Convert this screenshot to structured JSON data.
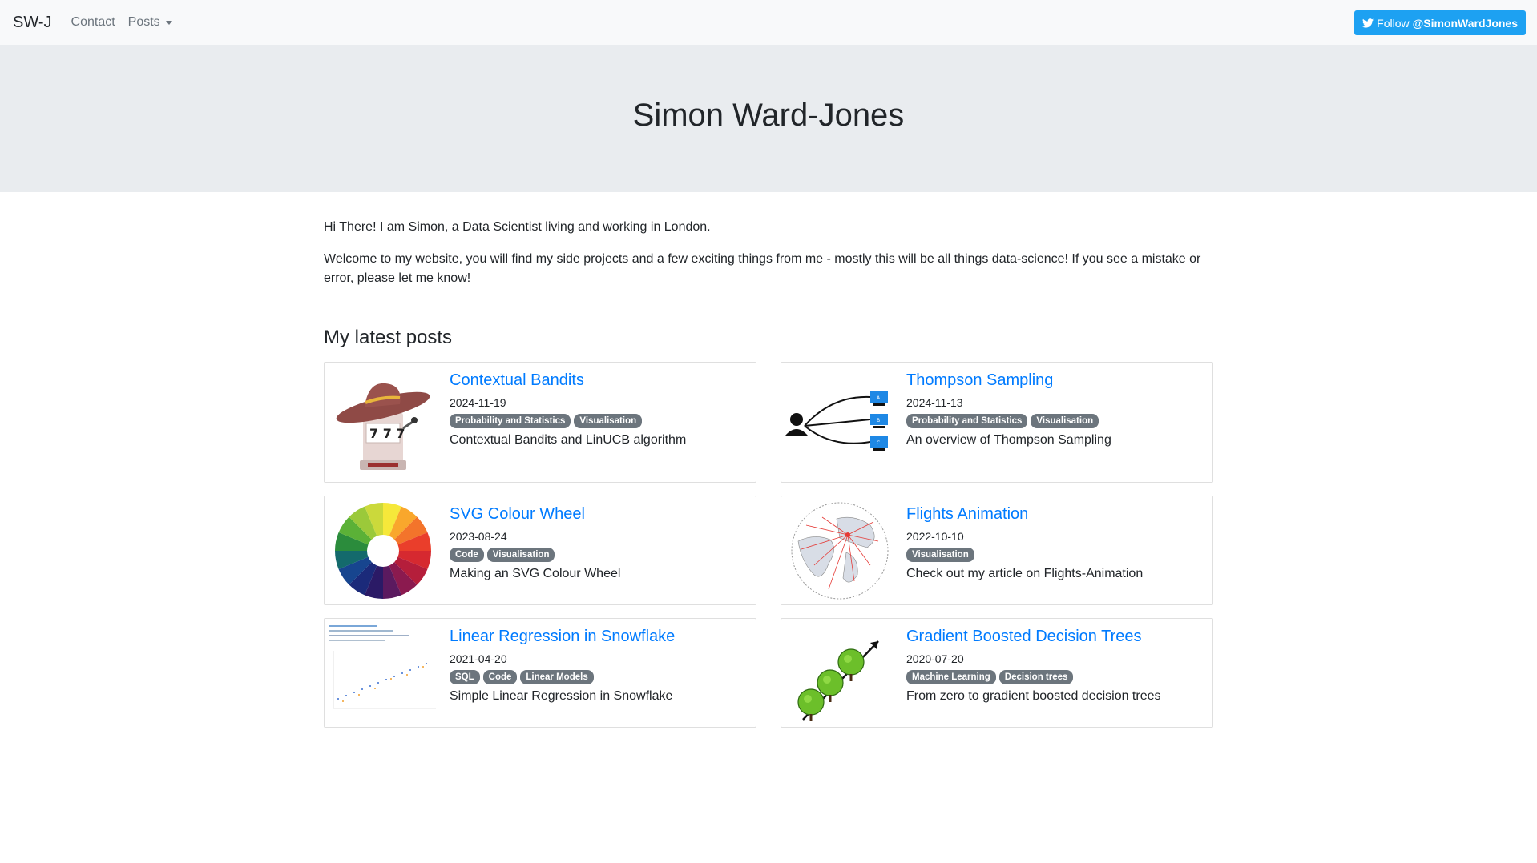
{
  "nav": {
    "brand": "SW-J",
    "contact": "Contact",
    "posts": "Posts",
    "follow_prefix": "Follow",
    "follow_handle": "@SimonWardJones"
  },
  "hero": {
    "title": "Simon Ward-Jones"
  },
  "intro": [
    "Hi There! I am Simon, a Data Scientist living and working in London.",
    "Welcome to my website, you will find my side projects and a few exciting things from me - mostly this will be all things data-science! If you see a mistake or error, please let me know!"
  ],
  "section_title": "My latest posts",
  "posts": [
    {
      "title": "Contextual Bandits",
      "date": "2024-11-19",
      "tags": [
        "Probability and Statistics",
        "Visualisation"
      ],
      "description": "Contextual Bandits and LinUCB algorithm",
      "icon": "slot-machine-cowboy-icon"
    },
    {
      "title": "Thompson Sampling",
      "date": "2024-11-13",
      "tags": [
        "Probability and Statistics",
        "Visualisation"
      ],
      "description": "An overview of Thompson Sampling",
      "icon": "user-choice-diagram-icon"
    },
    {
      "title": "SVG Colour Wheel",
      "date": "2023-08-24",
      "tags": [
        "Code",
        "Visualisation"
      ],
      "description": "Making an SVG Colour Wheel",
      "icon": "colour-wheel-icon"
    },
    {
      "title": "Flights Animation",
      "date": "2022-10-10",
      "tags": [
        "Visualisation"
      ],
      "description": "Check out my article on Flights-Animation",
      "icon": "globe-flights-icon"
    },
    {
      "title": "Linear Regression in Snowflake",
      "date": "2021-04-20",
      "tags": [
        "SQL",
        "Code",
        "Linear Models"
      ],
      "description": "Simple Linear Regression in Snowflake",
      "icon": "regression-plot-icon"
    },
    {
      "title": "Gradient Boosted Decision Trees",
      "date": "2020-07-20",
      "tags": [
        "Machine Learning",
        "Decision trees"
      ],
      "description": "From zero to gradient boosted decision trees",
      "icon": "trees-arrow-icon"
    }
  ],
  "colors": {
    "link": "#007bff",
    "twitter": "#1da1f2",
    "badge": "#6c757d",
    "hero_bg": "#e9ecef"
  }
}
